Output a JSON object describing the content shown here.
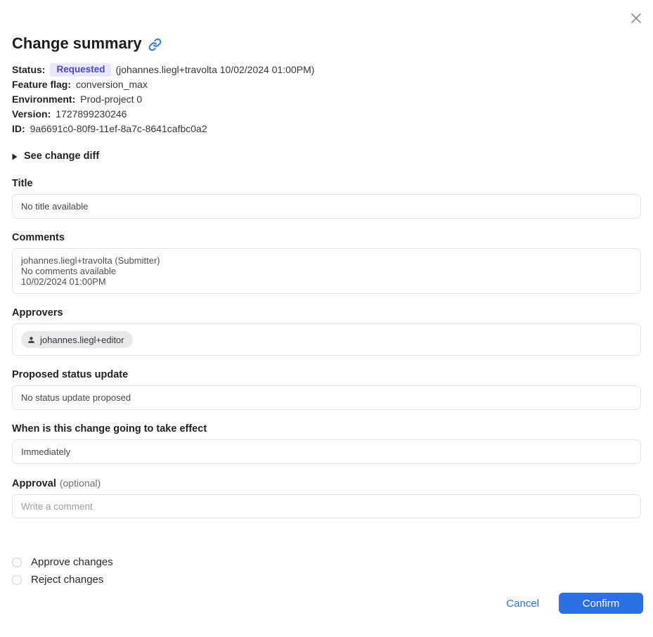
{
  "dialog": {
    "title": "Change summary"
  },
  "meta": {
    "status_label": "Status:",
    "status_badge": "Requested",
    "status_detail": "(johannes.liegl+travolta 10/02/2024 01:00PM)",
    "rows": [
      {
        "label": "Feature flag:",
        "value": "conversion_max"
      },
      {
        "label": "Environment:",
        "value": "Prod-project 0"
      },
      {
        "label": "Version:",
        "value": "1727899230246"
      },
      {
        "label": "ID:",
        "value": "9a6691c0-80f9-11ef-8a7c-8641cafbc0a2"
      }
    ]
  },
  "diff_toggle": {
    "label": "See change diff"
  },
  "sections": {
    "title": {
      "label": "Title",
      "value": "No title available"
    },
    "comments": {
      "label": "Comments",
      "lines": [
        "johannes.liegl+travolta (Submitter)",
        "No comments available",
        "10/02/2024 01:00PM"
      ]
    },
    "approvers": {
      "label": "Approvers",
      "chip": "johannes.liegl+editor"
    },
    "status_update": {
      "label": "Proposed status update",
      "value": "No status update proposed"
    },
    "effect": {
      "label": "When is this change going to take effect",
      "value": "Immediately"
    },
    "approval": {
      "label": "Approval",
      "optional": "(optional)",
      "placeholder": "Write a comment"
    }
  },
  "choices": [
    {
      "label": "Approve changes"
    },
    {
      "label": "Reject changes"
    }
  ],
  "footer": {
    "cancel": "Cancel",
    "confirm": "Confirm"
  },
  "colors": {
    "accent_blue": "#2b6fe4",
    "link_icon_blue": "#2470f4",
    "badge_bg": "#e8e7fb",
    "badge_text": "#4a47c9",
    "box_border": "#e3e4e6",
    "chip_bg": "#e9e8ea"
  }
}
